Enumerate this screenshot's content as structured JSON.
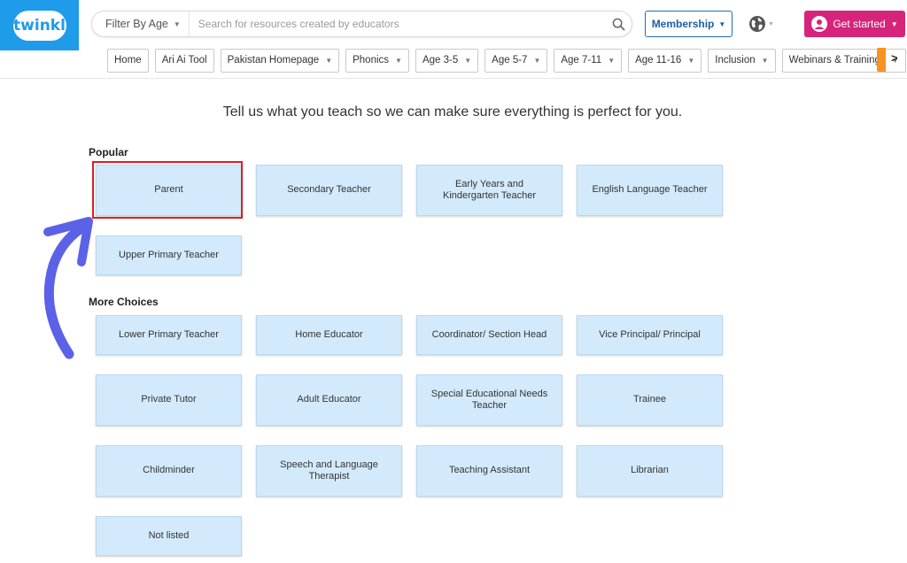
{
  "header": {
    "logo_text": "twinkl",
    "filter_label": "Filter By Age",
    "search_placeholder": "Search for resources created by educators",
    "membership_label": "Membership",
    "get_started_label": "Get started"
  },
  "nav": {
    "items": [
      {
        "label": "Home",
        "dropdown": false
      },
      {
        "label": "Ari Ai Tool",
        "dropdown": false
      },
      {
        "label": "Pakistan Homepage",
        "dropdown": true
      },
      {
        "label": "Phonics",
        "dropdown": true
      },
      {
        "label": "Age 3-5",
        "dropdown": true
      },
      {
        "label": "Age 5-7",
        "dropdown": true
      },
      {
        "label": "Age 7-11",
        "dropdown": true
      },
      {
        "label": "Age 11-16",
        "dropdown": true
      },
      {
        "label": "Inclusion",
        "dropdown": true
      },
      {
        "label": "Webinars & Trainings",
        "dropdown": true
      }
    ],
    "next_label": ">"
  },
  "main": {
    "headline": "Tell us what you teach so we can make sure everything is perfect for you.",
    "popular": {
      "label": "Popular",
      "roles": [
        "Parent",
        "Secondary Teacher",
        "Early Years and Kindergarten Teacher",
        "English Language Teacher",
        "Upper Primary Teacher"
      ]
    },
    "more": {
      "label": "More Choices",
      "roles": [
        "Lower Primary Teacher",
        "Home Educator",
        "Coordinator/ Section Head",
        "Vice Principal/ Principal",
        "Private Tutor",
        "Adult Educator",
        "Special Educational Needs Teacher",
        "Trainee",
        "Childminder",
        "Speech and Language Therapist",
        "Teaching Assistant",
        "Librarian",
        "Not listed"
      ]
    },
    "highlighted_role": "Parent"
  },
  "colors": {
    "brand_blue": "#1e9be9",
    "card_bg": "#d3eafc",
    "get_started_pink": "#d6247a",
    "highlight_red": "#e01b24",
    "arrow_blue": "#5b62e8"
  }
}
